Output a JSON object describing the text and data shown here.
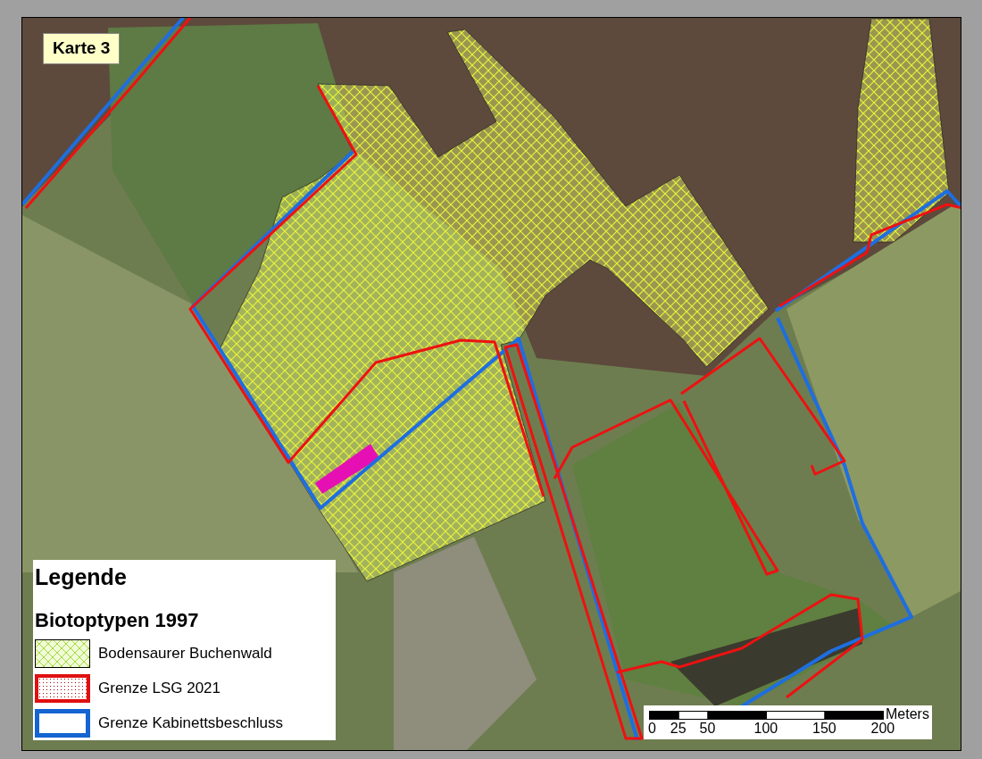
{
  "map_label": "Karte 3",
  "legend": {
    "title": "Legende",
    "subtitle": "Biotoptypen 1997",
    "items": [
      {
        "label": "Bodensaurer Buchenwald",
        "kind": "hatch"
      },
      {
        "label": "Grenze LSG 2021",
        "kind": "dotted-outline"
      },
      {
        "label": "Grenze Kabinettsbeschluss",
        "kind": "outline"
      }
    ]
  },
  "scale_bar": {
    "unit": "Meters",
    "labels": [
      "0",
      "25",
      "50",
      "100",
      "150",
      "200"
    ]
  }
}
